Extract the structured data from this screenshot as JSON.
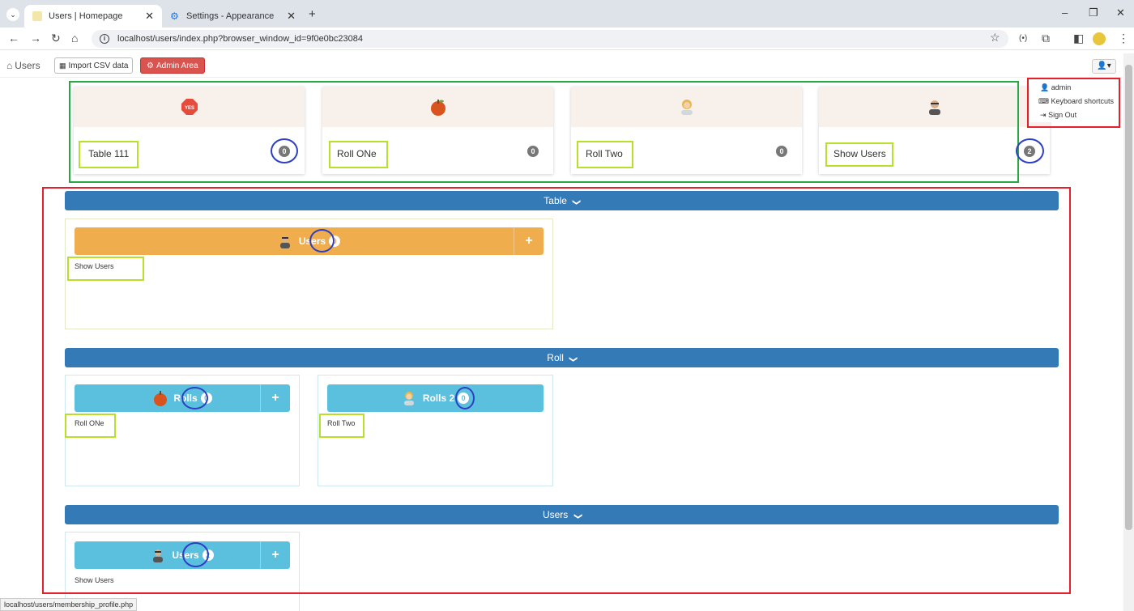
{
  "browser": {
    "tabs": [
      {
        "title": "Users | Homepage",
        "active": true
      },
      {
        "title": "Settings - Appearance",
        "active": false
      }
    ],
    "new_tab": "+",
    "url": "localhost/users/index.php?browser_window_id=9f0e0bc23084"
  },
  "toolbar": {
    "home_label": "Users",
    "import_label": "Import CSV data",
    "admin_label": "Admin Area"
  },
  "summary_cards": [
    {
      "title": "Table 111",
      "count": "0",
      "icon": "stop-sign-icon"
    },
    {
      "title": "Roll ONe",
      "count": "0",
      "icon": "apple-icon"
    },
    {
      "title": "Roll Two",
      "count": "0",
      "icon": "woman-icon"
    },
    {
      "title": "Show Users",
      "count": "2",
      "icon": "user-suit-icon"
    }
  ],
  "sections": [
    {
      "title": "Table",
      "chevron": "❯"
    },
    {
      "title": "Roll",
      "chevron": "❯"
    },
    {
      "title": "Users",
      "chevron": "❯"
    }
  ],
  "panels": {
    "table_users": {
      "label": "Users",
      "count": "0",
      "link": "Show Users"
    },
    "roll_rolls": {
      "label": "Rolls",
      "count": "0",
      "link": "Roll ONe"
    },
    "roll_rolls2": {
      "label": "Rolls 2",
      "count": "0",
      "link": "Roll Two"
    },
    "users_users": {
      "label": "Users",
      "count": "2",
      "link": "Show Users"
    }
  },
  "plus": "+",
  "dropdown": {
    "username": "admin",
    "shortcuts": "Keyboard shortcuts",
    "signout": "Sign Out"
  },
  "status_url": "localhost/users/membership_profile.php",
  "colors": {
    "primary": "#337ab7",
    "warning": "#f0ad4e",
    "info": "#5bc0de",
    "danger": "#d9534f",
    "annotation_green": "#27a844",
    "annotation_red": "#e3202b",
    "annotation_lime": "#b8e02a",
    "annotation_blue": "#2d3fc4"
  }
}
